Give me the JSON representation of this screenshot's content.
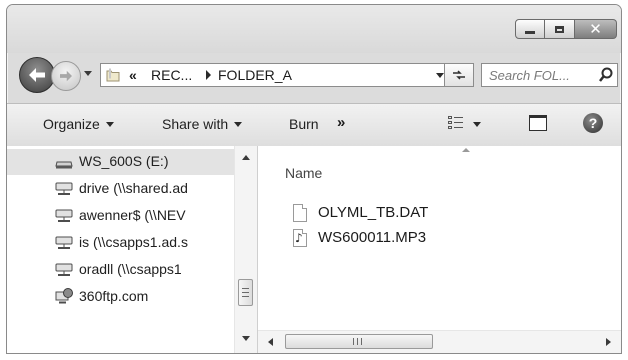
{
  "window": {
    "minimize_icon": "minimize-icon",
    "maximize_icon": "maximize-icon",
    "close_label": "✕"
  },
  "navigation": {
    "back_icon": "arrow-left-icon",
    "forward_icon": "arrow-right-icon",
    "address": {
      "overflow_chevrons": "«",
      "segment_1": "REC...",
      "segment_2": "FOLDER_A"
    },
    "search_placeholder": "Search FOL..."
  },
  "toolbar": {
    "organize": "Organize",
    "share_with": "Share with",
    "burn": "Burn",
    "more": "»",
    "help_label": "?"
  },
  "sidebar": {
    "items": [
      {
        "label": "WS_600S (E:)",
        "icon": "drive-icon",
        "selected": true
      },
      {
        "label": "drive (\\\\shared.ad",
        "icon": "network-drive-icon"
      },
      {
        "label": "awenner$ (\\\\NEV",
        "icon": "network-drive-icon"
      },
      {
        "label": "is (\\\\csapps1.ad.s",
        "icon": "network-drive-icon"
      },
      {
        "label": "oradll (\\\\csapps1",
        "icon": "network-drive-icon"
      },
      {
        "label": "360ftp.com",
        "icon": "network-location-icon"
      }
    ]
  },
  "content": {
    "column_header": "Name",
    "files": [
      {
        "name": "OLYML_TB.DAT",
        "icon": "file-icon"
      },
      {
        "name": "WS600011.MP3",
        "icon": "audio-file-icon"
      }
    ]
  },
  "colors": {
    "chrome": "#dcdcdc",
    "selected_row": "#e3e3e3",
    "pane_background": "#ffffff"
  }
}
